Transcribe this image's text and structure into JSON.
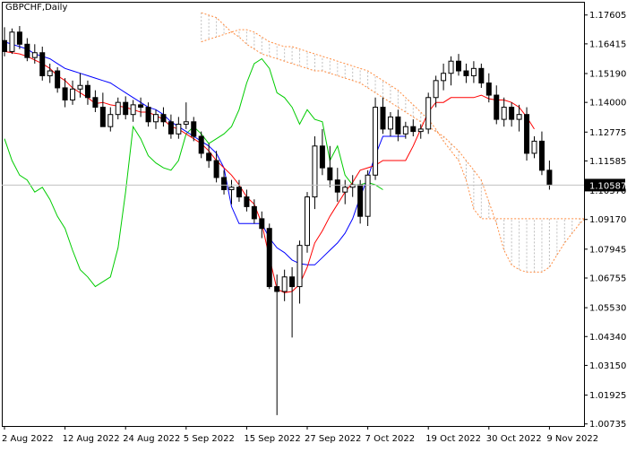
{
  "chart": {
    "symbol_label": "GBPCHF,Daily",
    "current_price_label": "1.10587"
  },
  "chart_data": {
    "type": "candlestick",
    "title": "GBPCHF,Daily",
    "symbol": "GBPCHF",
    "timeframe": "Daily",
    "ylim": [
      1.0065,
      1.1815
    ],
    "y_ticks": [
      "1.17605",
      "1.16415",
      "1.15190",
      "1.14000",
      "1.12775",
      "1.11585",
      "1.10370",
      "1.09170",
      "1.07945",
      "1.06755",
      "1.05530",
      "1.04340",
      "1.03150",
      "1.01925",
      "1.00735"
    ],
    "x_tick_labels": [
      {
        "index": 0,
        "label": "2 Aug 2022"
      },
      {
        "index": 8,
        "label": "12 Aug 2022"
      },
      {
        "index": 16,
        "label": "24 Aug 2022"
      },
      {
        "index": 24,
        "label": "5 Sep 2022"
      },
      {
        "index": 32,
        "label": "15 Sep 2022"
      },
      {
        "index": 40,
        "label": "27 Sep 2022"
      },
      {
        "index": 48,
        "label": "7 Oct 2022"
      },
      {
        "index": 56,
        "label": "19 Oct 2022"
      },
      {
        "index": 64,
        "label": "30 Oct 2022"
      },
      {
        "index": 72,
        "label": "9 Nov 2022"
      }
    ],
    "current_price": 1.10587,
    "grid": false,
    "colors": {
      "bull": "#ffffff",
      "bear": "#000000",
      "wick": "#000000",
      "tenkan": "#ff0000",
      "kijun": "#0000ff",
      "chikou": "#00cc00",
      "senkou": "#ff8c40",
      "cloud_hatch": "#c0c0c0",
      "price_line": "#c0c0c0"
    },
    "ohlc": [
      [
        1.1655,
        1.171,
        1.159,
        1.161
      ],
      [
        1.161,
        1.1705,
        1.16,
        1.169
      ],
      [
        1.169,
        1.1715,
        1.162,
        1.164
      ],
      [
        1.164,
        1.1665,
        1.157,
        1.1585
      ],
      [
        1.1585,
        1.164,
        1.156,
        1.1605
      ],
      [
        1.1605,
        1.163,
        1.149,
        1.151
      ],
      [
        1.151,
        1.156,
        1.148,
        1.153
      ],
      [
        1.153,
        1.1545,
        1.144,
        1.146
      ],
      [
        1.146,
        1.15,
        1.138,
        1.141
      ],
      [
        1.141,
        1.149,
        1.139,
        1.1455
      ],
      [
        1.1455,
        1.152,
        1.142,
        1.147
      ],
      [
        1.147,
        1.149,
        1.139,
        1.142
      ],
      [
        1.142,
        1.145,
        1.136,
        1.138
      ],
      [
        1.138,
        1.144,
        1.134,
        1.13
      ],
      [
        1.13,
        1.138,
        1.128,
        1.135
      ],
      [
        1.135,
        1.142,
        1.133,
        1.14
      ],
      [
        1.14,
        1.1425,
        1.133,
        1.135
      ],
      [
        1.135,
        1.141,
        1.132,
        1.139
      ],
      [
        1.139,
        1.142,
        1.134,
        1.138
      ],
      [
        1.138,
        1.14,
        1.13,
        1.132
      ],
      [
        1.132,
        1.137,
        1.129,
        1.135
      ],
      [
        1.135,
        1.138,
        1.13,
        1.132
      ],
      [
        1.132,
        1.135,
        1.125,
        1.127
      ],
      [
        1.127,
        1.134,
        1.125,
        1.131
      ],
      [
        1.131,
        1.14,
        1.129,
        1.132
      ],
      [
        1.132,
        1.134,
        1.124,
        1.126
      ],
      [
        1.126,
        1.128,
        1.117,
        1.119
      ],
      [
        1.119,
        1.123,
        1.113,
        1.116
      ],
      [
        1.116,
        1.12,
        1.107,
        1.109
      ],
      [
        1.109,
        1.112,
        1.102,
        1.104
      ],
      [
        1.104,
        1.108,
        1.098,
        1.105
      ],
      [
        1.105,
        1.108,
        1.099,
        1.101
      ],
      [
        1.101,
        1.104,
        1.095,
        1.097
      ],
      [
        1.097,
        1.1,
        1.09,
        1.092
      ],
      [
        1.092,
        1.095,
        1.084,
        1.088
      ],
      [
        1.088,
        1.09,
        1.063,
        1.064
      ],
      [
        1.064,
        1.069,
        1.011,
        1.062
      ],
      [
        1.062,
        1.071,
        1.058,
        1.068
      ],
      [
        1.068,
        1.072,
        1.043,
        1.064
      ],
      [
        1.064,
        1.083,
        1.057,
        1.081
      ],
      [
        1.081,
        1.103,
        1.078,
        1.101
      ],
      [
        1.101,
        1.126,
        1.096,
        1.122
      ],
      [
        1.122,
        1.129,
        1.11,
        1.113
      ],
      [
        1.113,
        1.122,
        1.105,
        1.108
      ],
      [
        1.108,
        1.113,
        1.099,
        1.103
      ],
      [
        1.103,
        1.108,
        1.098,
        1.105
      ],
      [
        1.105,
        1.11,
        1.101,
        1.106
      ],
      [
        1.106,
        1.108,
        1.09,
        1.093
      ],
      [
        1.093,
        1.112,
        1.089,
        1.11
      ],
      [
        1.11,
        1.142,
        1.108,
        1.138
      ],
      [
        1.138,
        1.142,
        1.127,
        1.129
      ],
      [
        1.129,
        1.136,
        1.126,
        1.134
      ],
      [
        1.134,
        1.137,
        1.124,
        1.127
      ],
      [
        1.127,
        1.132,
        1.125,
        1.13
      ],
      [
        1.13,
        1.133,
        1.126,
        1.128
      ],
      [
        1.128,
        1.131,
        1.125,
        1.129
      ],
      [
        1.129,
        1.144,
        1.127,
        1.142
      ],
      [
        1.142,
        1.151,
        1.138,
        1.149
      ],
      [
        1.149,
        1.156,
        1.145,
        1.152
      ],
      [
        1.152,
        1.159,
        1.147,
        1.157
      ],
      [
        1.157,
        1.16,
        1.151,
        1.153
      ],
      [
        1.153,
        1.156,
        1.148,
        1.151
      ],
      [
        1.151,
        1.157,
        1.148,
        1.154
      ],
      [
        1.154,
        1.156,
        1.146,
        1.148
      ],
      [
        1.148,
        1.152,
        1.14,
        1.143
      ],
      [
        1.143,
        1.147,
        1.131,
        1.133
      ],
      [
        1.133,
        1.142,
        1.13,
        1.138
      ],
      [
        1.138,
        1.14,
        1.13,
        1.133
      ],
      [
        1.133,
        1.139,
        1.128,
        1.135
      ],
      [
        1.135,
        1.138,
        1.116,
        1.119
      ],
      [
        1.119,
        1.126,
        1.117,
        1.124
      ],
      [
        1.124,
        1.128,
        1.11,
        1.112
      ],
      [
        1.112,
        1.116,
        1.104,
        1.1059
      ]
    ],
    "tenkan_sen": [
      1.161,
      1.1605,
      1.16,
      1.159,
      1.1575,
      1.156,
      1.154,
      1.151,
      1.149,
      1.146,
      1.144,
      1.142,
      1.1395,
      1.14,
      1.139,
      1.1385,
      1.138,
      1.137,
      1.136,
      1.136,
      1.1345,
      1.133,
      1.13,
      1.129,
      1.127,
      1.125,
      1.123,
      1.12,
      1.116,
      1.113,
      1.11,
      1.106,
      1.101,
      1.098,
      1.09,
      1.076,
      1.063,
      1.0615,
      1.062,
      1.065,
      1.072,
      1.082,
      1.087,
      1.093,
      1.098,
      1.103,
      1.107,
      1.112,
      1.113,
      1.114,
      1.116,
      1.116,
      1.116,
      1.116,
      1.122,
      1.129,
      1.136,
      1.14,
      1.14,
      1.142,
      1.142,
      1.142,
      1.142,
      1.143,
      1.1415,
      1.141,
      1.141,
      1.14,
      1.138,
      1.134,
      1.129
    ],
    "kijun_sen": [
      1.165,
      1.164,
      1.163,
      1.162,
      1.16,
      1.159,
      1.158,
      1.156,
      1.154,
      1.153,
      1.152,
      1.151,
      1.15,
      1.149,
      1.148,
      1.146,
      1.144,
      1.142,
      1.14,
      1.138,
      1.137,
      1.135,
      1.132,
      1.13,
      1.128,
      1.126,
      1.124,
      1.122,
      1.119,
      1.113,
      1.097,
      1.09,
      1.09,
      1.09,
      1.09,
      1.084,
      1.08,
      1.078,
      1.075,
      1.0735,
      1.073,
      1.073,
      1.076,
      1.079,
      1.082,
      1.086,
      1.092,
      1.101,
      1.109,
      1.118,
      1.126,
      1.126,
      1.126,
      1.126
    ],
    "chikou_span": [
      1.125,
      1.116,
      1.11,
      1.108,
      1.103,
      1.105,
      1.1,
      1.093,
      1.088,
      1.079,
      1.071,
      1.068,
      1.064,
      1.066,
      1.068,
      1.08,
      1.103,
      1.13,
      1.125,
      1.118,
      1.115,
      1.113,
      1.112,
      1.116,
      1.127,
      1.13,
      1.127,
      1.123,
      1.125,
      1.127,
      1.13,
      1.137,
      1.148,
      1.156,
      1.158,
      1.154,
      1.144,
      1.142,
      1.138,
      1.131,
      1.137,
      1.133,
      1.132,
      1.116,
      1.122,
      1.11,
      1.1059,
      1.106,
      1.107,
      1.106,
      1.104
    ],
    "senkou_span_a": [
      1.177,
      1.176,
      1.175,
      1.172,
      1.169,
      1.167,
      1.164,
      1.162,
      1.16,
      1.159,
      1.158,
      1.157,
      1.156,
      1.155,
      1.154,
      1.153,
      1.153,
      1.152,
      1.151,
      1.15,
      1.149,
      1.148,
      1.146,
      1.144,
      1.142,
      1.14,
      1.138,
      1.136,
      1.134,
      1.132,
      1.13,
      1.128,
      1.126,
      1.123,
      1.12,
      1.116,
      1.112,
      1.108,
      1.099,
      1.09,
      1.079,
      1.073,
      1.071,
      1.07,
      1.07,
      1.07,
      1.072,
      1.077,
      1.082,
      1.086,
      1.09,
      1.093,
      1.095,
      1.097,
      1.099,
      1.101
    ],
    "senkou_span_b": [
      1.165,
      1.166,
      1.167,
      1.168,
      1.169,
      1.17,
      1.17,
      1.169,
      1.167,
      1.165,
      1.164,
      1.163,
      1.163,
      1.162,
      1.161,
      1.16,
      1.159,
      1.158,
      1.157,
      1.156,
      1.155,
      1.154,
      1.153,
      1.151,
      1.149,
      1.147,
      1.145,
      1.142,
      1.139,
      1.136,
      1.133,
      1.129,
      1.124,
      1.12,
      1.116,
      1.108,
      1.096,
      1.092,
      1.092,
      1.092,
      1.092,
      1.092,
      1.092,
      1.092,
      1.092,
      1.092,
      1.092,
      1.092,
      1.092,
      1.092,
      1.092,
      1.092,
      1.092,
      1.092,
      1.092,
      1.092
    ]
  }
}
